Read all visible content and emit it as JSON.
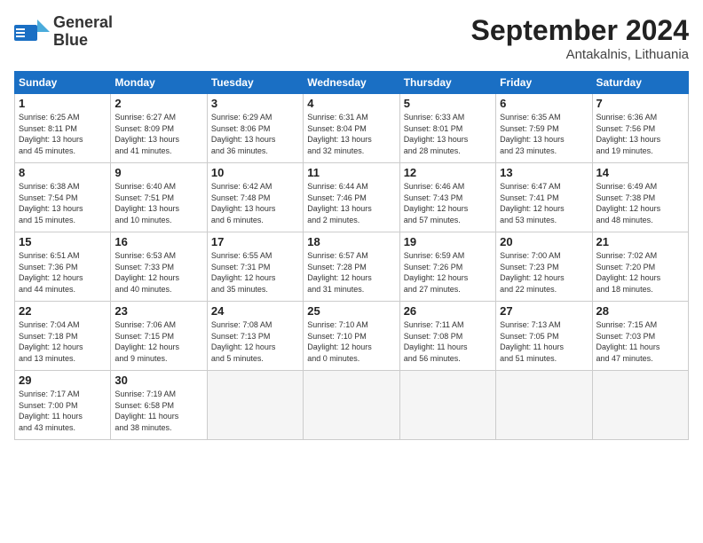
{
  "header": {
    "logo_line1": "General",
    "logo_line2": "Blue",
    "month_title": "September 2024",
    "location": "Antakalnis, Lithuania"
  },
  "weekdays": [
    "Sunday",
    "Monday",
    "Tuesday",
    "Wednesday",
    "Thursday",
    "Friday",
    "Saturday"
  ],
  "weeks": [
    [
      {
        "day": "1",
        "info": "Sunrise: 6:25 AM\nSunset: 8:11 PM\nDaylight: 13 hours\nand 45 minutes."
      },
      {
        "day": "2",
        "info": "Sunrise: 6:27 AM\nSunset: 8:09 PM\nDaylight: 13 hours\nand 41 minutes."
      },
      {
        "day": "3",
        "info": "Sunrise: 6:29 AM\nSunset: 8:06 PM\nDaylight: 13 hours\nand 36 minutes."
      },
      {
        "day": "4",
        "info": "Sunrise: 6:31 AM\nSunset: 8:04 PM\nDaylight: 13 hours\nand 32 minutes."
      },
      {
        "day": "5",
        "info": "Sunrise: 6:33 AM\nSunset: 8:01 PM\nDaylight: 13 hours\nand 28 minutes."
      },
      {
        "day": "6",
        "info": "Sunrise: 6:35 AM\nSunset: 7:59 PM\nDaylight: 13 hours\nand 23 minutes."
      },
      {
        "day": "7",
        "info": "Sunrise: 6:36 AM\nSunset: 7:56 PM\nDaylight: 13 hours\nand 19 minutes."
      }
    ],
    [
      {
        "day": "8",
        "info": "Sunrise: 6:38 AM\nSunset: 7:54 PM\nDaylight: 13 hours\nand 15 minutes."
      },
      {
        "day": "9",
        "info": "Sunrise: 6:40 AM\nSunset: 7:51 PM\nDaylight: 13 hours\nand 10 minutes."
      },
      {
        "day": "10",
        "info": "Sunrise: 6:42 AM\nSunset: 7:48 PM\nDaylight: 13 hours\nand 6 minutes."
      },
      {
        "day": "11",
        "info": "Sunrise: 6:44 AM\nSunset: 7:46 PM\nDaylight: 13 hours\nand 2 minutes."
      },
      {
        "day": "12",
        "info": "Sunrise: 6:46 AM\nSunset: 7:43 PM\nDaylight: 12 hours\nand 57 minutes."
      },
      {
        "day": "13",
        "info": "Sunrise: 6:47 AM\nSunset: 7:41 PM\nDaylight: 12 hours\nand 53 minutes."
      },
      {
        "day": "14",
        "info": "Sunrise: 6:49 AM\nSunset: 7:38 PM\nDaylight: 12 hours\nand 48 minutes."
      }
    ],
    [
      {
        "day": "15",
        "info": "Sunrise: 6:51 AM\nSunset: 7:36 PM\nDaylight: 12 hours\nand 44 minutes."
      },
      {
        "day": "16",
        "info": "Sunrise: 6:53 AM\nSunset: 7:33 PM\nDaylight: 12 hours\nand 40 minutes."
      },
      {
        "day": "17",
        "info": "Sunrise: 6:55 AM\nSunset: 7:31 PM\nDaylight: 12 hours\nand 35 minutes."
      },
      {
        "day": "18",
        "info": "Sunrise: 6:57 AM\nSunset: 7:28 PM\nDaylight: 12 hours\nand 31 minutes."
      },
      {
        "day": "19",
        "info": "Sunrise: 6:59 AM\nSunset: 7:26 PM\nDaylight: 12 hours\nand 27 minutes."
      },
      {
        "day": "20",
        "info": "Sunrise: 7:00 AM\nSunset: 7:23 PM\nDaylight: 12 hours\nand 22 minutes."
      },
      {
        "day": "21",
        "info": "Sunrise: 7:02 AM\nSunset: 7:20 PM\nDaylight: 12 hours\nand 18 minutes."
      }
    ],
    [
      {
        "day": "22",
        "info": "Sunrise: 7:04 AM\nSunset: 7:18 PM\nDaylight: 12 hours\nand 13 minutes."
      },
      {
        "day": "23",
        "info": "Sunrise: 7:06 AM\nSunset: 7:15 PM\nDaylight: 12 hours\nand 9 minutes."
      },
      {
        "day": "24",
        "info": "Sunrise: 7:08 AM\nSunset: 7:13 PM\nDaylight: 12 hours\nand 5 minutes."
      },
      {
        "day": "25",
        "info": "Sunrise: 7:10 AM\nSunset: 7:10 PM\nDaylight: 12 hours\nand 0 minutes."
      },
      {
        "day": "26",
        "info": "Sunrise: 7:11 AM\nSunset: 7:08 PM\nDaylight: 11 hours\nand 56 minutes."
      },
      {
        "day": "27",
        "info": "Sunrise: 7:13 AM\nSunset: 7:05 PM\nDaylight: 11 hours\nand 51 minutes."
      },
      {
        "day": "28",
        "info": "Sunrise: 7:15 AM\nSunset: 7:03 PM\nDaylight: 11 hours\nand 47 minutes."
      }
    ],
    [
      {
        "day": "29",
        "info": "Sunrise: 7:17 AM\nSunset: 7:00 PM\nDaylight: 11 hours\nand 43 minutes."
      },
      {
        "day": "30",
        "info": "Sunrise: 7:19 AM\nSunset: 6:58 PM\nDaylight: 11 hours\nand 38 minutes."
      },
      {
        "day": "",
        "info": ""
      },
      {
        "day": "",
        "info": ""
      },
      {
        "day": "",
        "info": ""
      },
      {
        "day": "",
        "info": ""
      },
      {
        "day": "",
        "info": ""
      }
    ]
  ]
}
